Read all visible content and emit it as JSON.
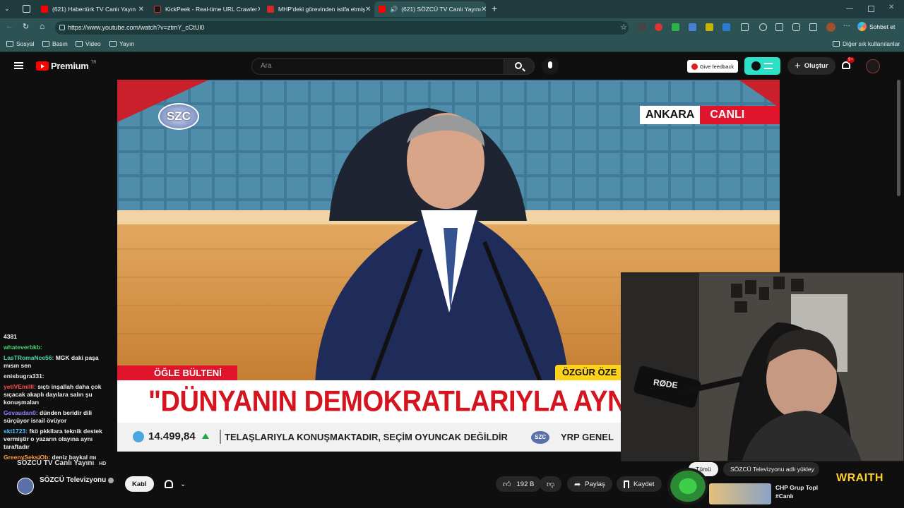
{
  "browser": {
    "tabs": [
      {
        "title": "(621) Habertürk TV Canlı Yayın",
        "color": "#ff0000"
      },
      {
        "title": "KickPeek - Real-time URL Crawler",
        "color": "#333333"
      },
      {
        "title": "MHP'deki görevinden istifa etmiş",
        "color": "#d62828"
      },
      {
        "title": "(621) SÖZCÜ TV Canlı Yayını",
        "color": "#ff0000"
      }
    ],
    "new_tab": "+",
    "url": "https://www.youtube.com/watch?v=ztmY_cCtUl0",
    "chat_btn": "Sohbet et",
    "bookmarks": [
      "Sosyal",
      "Basın",
      "Video",
      "Yayın"
    ],
    "other_bookmarks": "Diğer sık kullanılanlar"
  },
  "youtube": {
    "logo": "Premium",
    "logo_sup": "TR",
    "search_placeholder": "Ara",
    "feedback": "Give feedback",
    "create": "Oluştur",
    "notif_badge": "9+"
  },
  "video": {
    "channel_logo": "SZC",
    "location": "ANKARA",
    "live": "CANLI",
    "segment": "ÖĞLE BÜLTENİ",
    "speaker": "ÖZGÜR ÖZE",
    "headline": "\"DÜNYANIN DEMOKRATLARIYLA AYNI",
    "index_value": "14.499,84",
    "ticker": "TELAŞLARIYLA KONUŞMAKTADIR, SEÇİM OYUNCAK DEĞİLDİR",
    "ticker_logo": "SZC",
    "ticker2": "YRP GENEL"
  },
  "webcam": {
    "mic_brand": "RØDE"
  },
  "chat": {
    "count": "4381",
    "messages": [
      {
        "user": "whateverbkb:",
        "text": "",
        "color": "#44d66d"
      },
      {
        "user": "LasTRomaNce56:",
        "text": "MGK daki paşa mısın sen",
        "color": "#4fd6b4"
      },
      {
        "user": "enisbugra331:",
        "text": "",
        "color": "#e8e8e8"
      },
      {
        "user": "yetiVEmilll:",
        "text": "sıçtı inşallah daha çok sıçacak akaplı dayılara salın şu konuşmaları",
        "color": "#ff4d4d"
      },
      {
        "user": "Gevaudan0:",
        "text": "dünden beridir dili sürçüyor israil övüyor",
        "color": "#9b7cff"
      },
      {
        "user": "skt1723:",
        "text": "fkö pkkllara teknik destek vermiştir o yazarın olayına aynı taraftadır",
        "color": "#55c8ff"
      },
      {
        "user": "GreenySeksiOb:",
        "text": "deniz baykal mı",
        "color": "#ff9b3b"
      }
    ]
  },
  "bottom": {
    "channel": "SÖZCÜ Televizyonu",
    "title_overlay": "SÖZCÜ TV Canlı Yayını",
    "hd": "HD",
    "join": "Katıl",
    "likes": "192 B",
    "share": "Paylaş",
    "save": "Kaydet",
    "rec_chip": "Tümü",
    "rec_chip2": "SÖZCÜ Televizyonu adlı yükley",
    "rec_title": "CHP Grup Topl #Canlı",
    "wraith": "WRAITH"
  }
}
